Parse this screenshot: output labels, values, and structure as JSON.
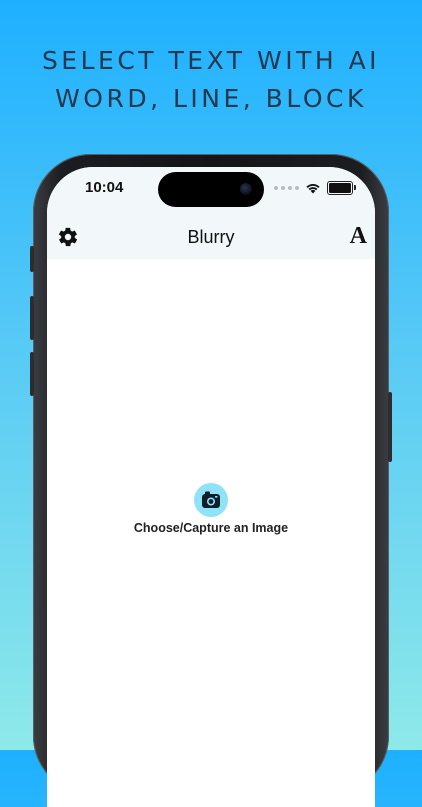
{
  "headline": {
    "line1": "SELECT TEXT WITH AI",
    "line2": "WORD, LINE, BLOCK"
  },
  "status_bar": {
    "time": "10:04"
  },
  "nav": {
    "title": "Blurry",
    "left_icon": "gear-icon",
    "right_icon": "font-icon",
    "right_glyph": "A"
  },
  "main": {
    "action_icon": "camera-icon",
    "action_label": "Choose/Capture an Image"
  },
  "colors": {
    "background_top": "#1eb0ff",
    "background_bottom": "#8ee9e9",
    "accent": "#8fe3f6",
    "nav_background": "#f2f8f9"
  }
}
